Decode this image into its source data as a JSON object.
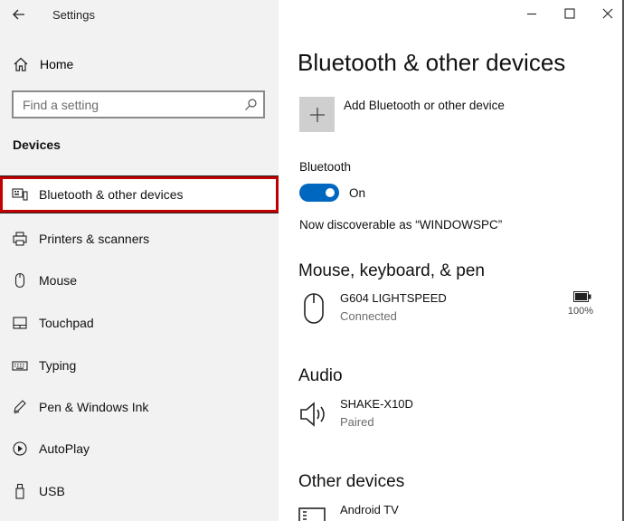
{
  "window": {
    "app_title": "Settings"
  },
  "sidebar": {
    "home_label": "Home",
    "search_placeholder": "Find a setting",
    "section_label": "Devices",
    "items": [
      {
        "label": "Bluetooth & other devices",
        "icon": "bluetooth-devices-icon",
        "selected": true
      },
      {
        "label": "Printers & scanners",
        "icon": "printer-icon",
        "selected": false
      },
      {
        "label": "Mouse",
        "icon": "mouse-icon",
        "selected": false
      },
      {
        "label": "Touchpad",
        "icon": "touchpad-icon",
        "selected": false
      },
      {
        "label": "Typing",
        "icon": "keyboard-icon",
        "selected": false
      },
      {
        "label": "Pen & Windows Ink",
        "icon": "pen-icon",
        "selected": false
      },
      {
        "label": "AutoPlay",
        "icon": "autoplay-icon",
        "selected": false
      },
      {
        "label": "USB",
        "icon": "usb-icon",
        "selected": false
      }
    ]
  },
  "main": {
    "title": "Bluetooth & other devices",
    "add_device_label": "Add Bluetooth or other device",
    "bluetooth_label": "Bluetooth",
    "bluetooth_state": "On",
    "discoverable_text": "Now discoverable as “WINDOWSPC”",
    "groups": [
      {
        "title": "Mouse, keyboard, & pen",
        "devices": [
          {
            "name": "G604 LIGHTSPEED",
            "status": "Connected",
            "icon": "mouse-icon",
            "battery": "100%"
          }
        ]
      },
      {
        "title": "Audio",
        "devices": [
          {
            "name": "SHAKE-X10D",
            "status": "Paired",
            "icon": "speaker-icon"
          }
        ]
      },
      {
        "title": "Other devices",
        "devices": [
          {
            "name": "Android TV",
            "status": "",
            "icon": "tv-icon"
          }
        ]
      }
    ]
  },
  "colors": {
    "accent": "#0067c0",
    "selection_border": "#c00000",
    "sidebar_bg": "#f2f2f2"
  }
}
